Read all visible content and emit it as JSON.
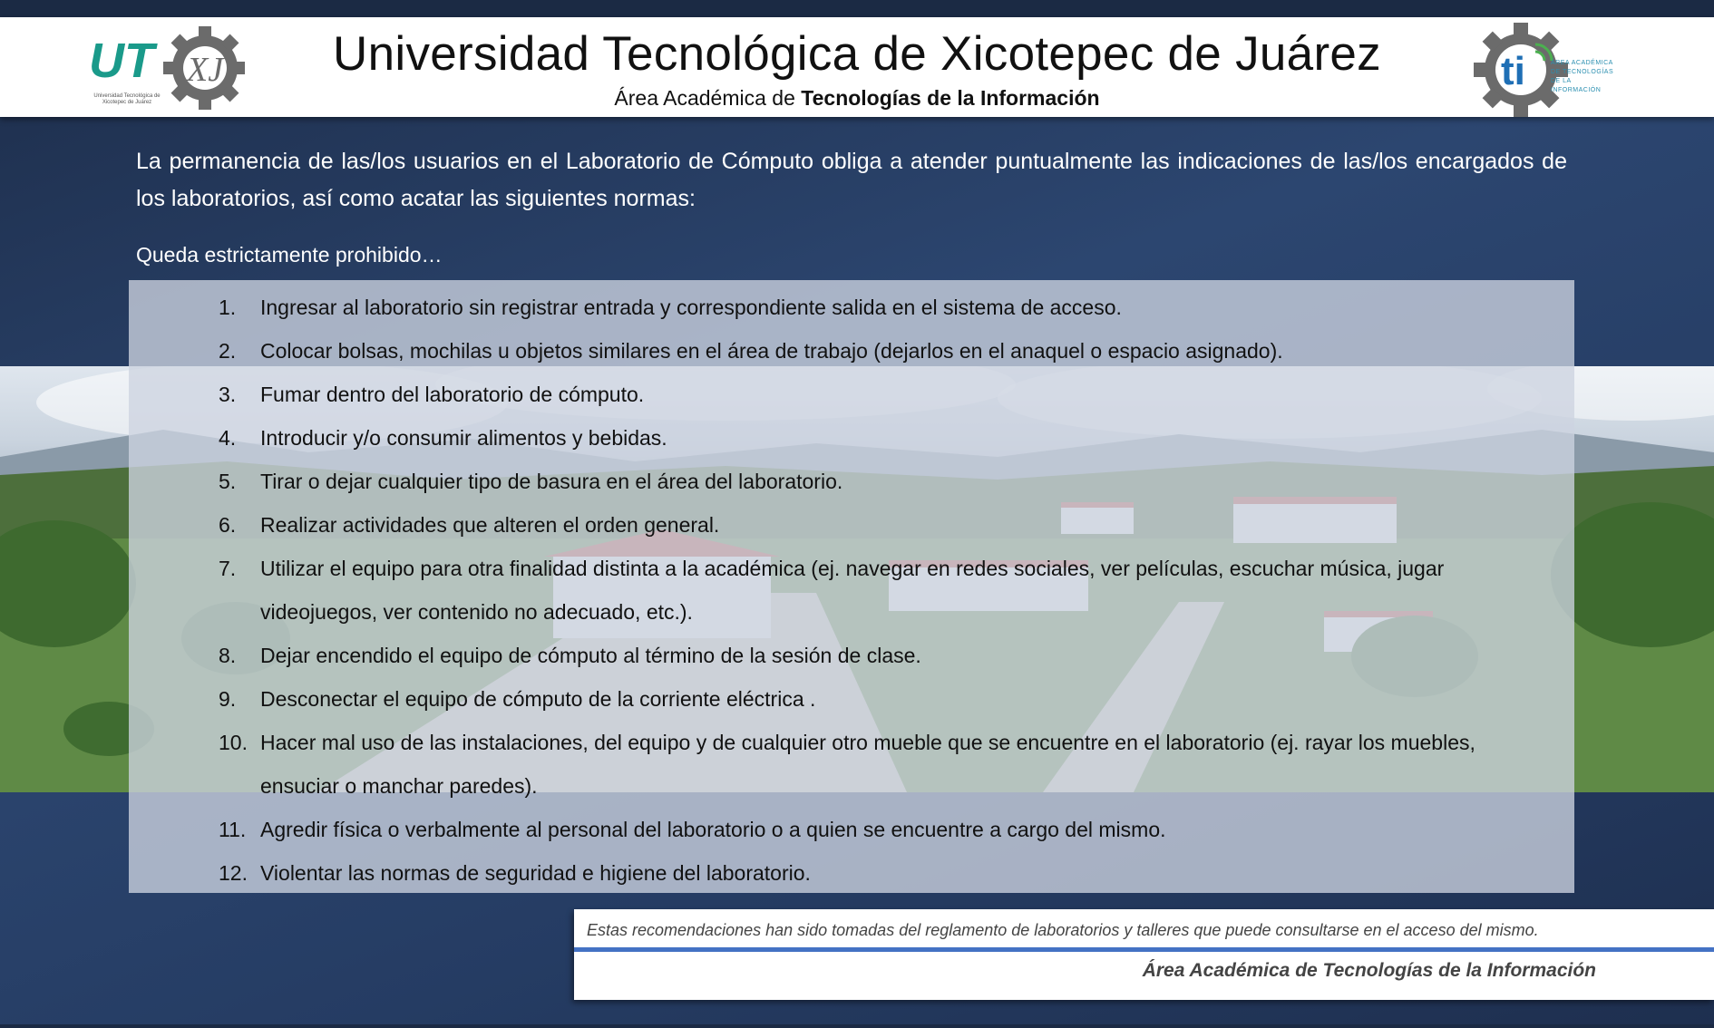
{
  "header": {
    "title": "Universidad Tecnológica de Xicotepec de Juárez",
    "subtitle_prefix": "Área Académica de ",
    "subtitle_bold": "Tecnologías de la Información",
    "left_logo": {
      "icon": "utxj-gear-logo",
      "text": "UTXJ",
      "caption": "Universidad Tecnológica de Xicotepec de Juárez",
      "colors": {
        "teal": "#1a9a8a",
        "gray": "#6b6b6b"
      }
    },
    "right_logo": {
      "icon": "ti-gear-logo",
      "text": "ti",
      "caption": "ÁREA ACADÉMICA DE TECNOLOGÍAS DE LA INFORMACIÓN",
      "colors": {
        "blue": "#1f6fb5",
        "gray": "#6b6b6b",
        "green": "#4caf50"
      }
    }
  },
  "body": {
    "intro": "La permanencia de las/los usuarios en el Laboratorio de Cómputo obliga a atender puntualmente las indicaciones de las/los encargados de los laboratorios, así como acatar las siguientes normas:",
    "prohibited_heading": "Queda estrictamente prohibido…",
    "rules": [
      {
        "num": "1.",
        "text": "Ingresar al laboratorio sin registrar entrada y correspondiente salida en el sistema de acceso."
      },
      {
        "num": "2.",
        "text": "Colocar bolsas, mochilas u objetos similares en el área de trabajo (dejarlos en el anaquel o espacio asignado)."
      },
      {
        "num": "3.",
        "text": "Fumar dentro del laboratorio de cómputo."
      },
      {
        "num": "4.",
        "text": "Introducir y/o consumir alimentos y bebidas."
      },
      {
        "num": "5.",
        "text": "Tirar o dejar cualquier tipo de basura en el área del laboratorio."
      },
      {
        "num": "6.",
        "text": "Realizar actividades que alteren el orden general."
      },
      {
        "num": "7.",
        "text": "Utilizar el equipo para otra finalidad distinta a la académica (ej. navegar en redes sociales, ver películas, escuchar música, jugar videojuegos, ver contenido no adecuado, etc.)."
      },
      {
        "num": "8.",
        "text": "Dejar encendido el equipo de cómputo al término de la sesión de clase."
      },
      {
        "num": "9.",
        "text": "Desconectar el equipo de cómputo de la corriente eléctrica ."
      },
      {
        "num": "10.",
        "text": "Hacer mal uso de las instalaciones, del equipo y de cualquier otro mueble que se encuentre en el laboratorio (ej. rayar los muebles, ensuciar o manchar paredes)."
      },
      {
        "num": "11.",
        "text": "Agredir física o verbalmente al personal del laboratorio o a quien se encuentre a cargo del mismo."
      },
      {
        "num": "12.",
        "text": "Violentar las normas de seguridad e higiene del laboratorio."
      }
    ]
  },
  "footer": {
    "note": "Estas recomendaciones han sido tomadas del reglamento de laboratorios y talleres que puede consultarse en el acceso del mismo.",
    "signature": "Área Académica de Tecnologías de la Información",
    "accent_color": "#4472c4"
  },
  "background": {
    "image": "campus-aerial-photo",
    "colors": {
      "navy": "#253c63",
      "sky": "#c9d3de",
      "grass": "#6f9a52"
    }
  }
}
